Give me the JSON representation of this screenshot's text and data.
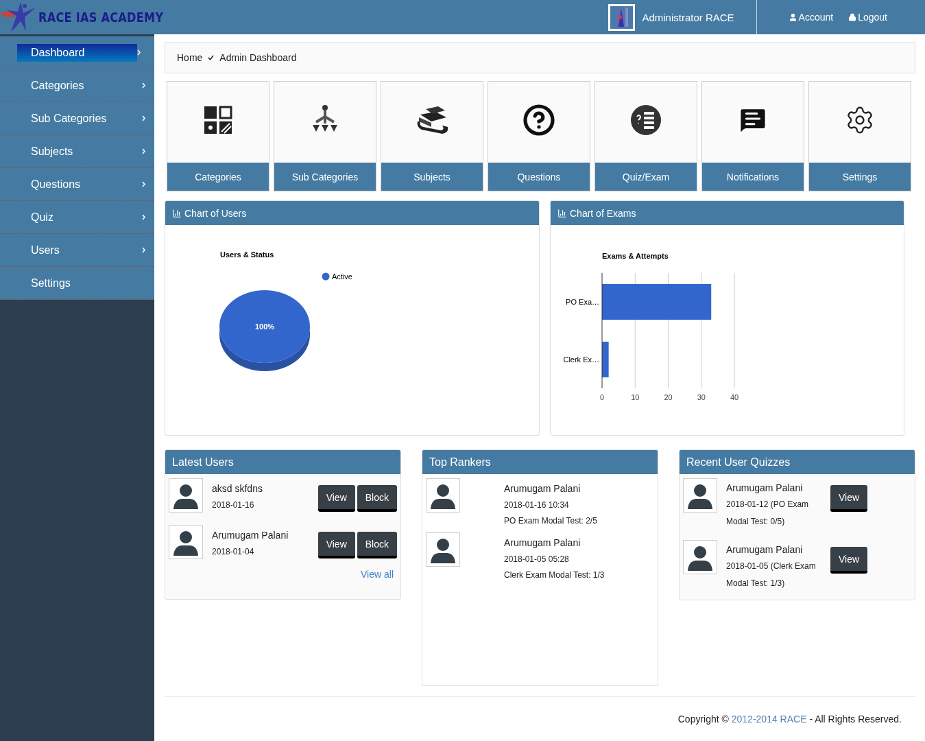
{
  "header": {
    "logo_text": "RACE IAS ACADEMY",
    "user_name": "Administrator RACE",
    "links": [
      {
        "kind": "account",
        "label": "Account"
      },
      {
        "kind": "logout",
        "label": "Logout"
      }
    ]
  },
  "sidebar": {
    "items": [
      {
        "label": "Dashboard",
        "selected": true,
        "has_arrow": true
      },
      {
        "label": "Categories",
        "selected": false,
        "has_arrow": true
      },
      {
        "label": "Sub Categories",
        "selected": false,
        "has_arrow": true
      },
      {
        "label": "Subjects",
        "selected": false,
        "has_arrow": true
      },
      {
        "label": "Questions",
        "selected": false,
        "has_arrow": true
      },
      {
        "label": "Quiz",
        "selected": false,
        "has_arrow": true
      },
      {
        "label": "Users",
        "selected": false,
        "has_arrow": true
      },
      {
        "label": "Settings",
        "selected": false,
        "has_arrow": false
      }
    ]
  },
  "breadcrumb": [
    "Home",
    "Admin Dashboard"
  ],
  "tiles": [
    {
      "kind": "categories",
      "label": "Categories"
    },
    {
      "kind": "subcategories",
      "label": "Sub Categories"
    },
    {
      "kind": "subjects",
      "label": "Subjects"
    },
    {
      "kind": "questions",
      "label": "Questions"
    },
    {
      "kind": "quiz",
      "label": "Quiz/Exam"
    },
    {
      "kind": "notifications",
      "label": "Notifications"
    },
    {
      "kind": "settings",
      "label": "Settings"
    }
  ],
  "charts": [
    {
      "title": "Chart of Users",
      "chart_data": {
        "type": "pie",
        "title": "Users & Status",
        "series": [
          {
            "name": "Active",
            "color": "#3366cc",
            "values": [
              100
            ]
          }
        ],
        "value_labels": [
          "100%"
        ]
      }
    },
    {
      "title": "Chart of Exams",
      "chart_data": {
        "type": "bar",
        "orientation": "horizontal",
        "title": "Exams & Attempts",
        "categories": [
          "PO Exa…",
          "Clerk Ex…"
        ],
        "values": [
          33,
          2
        ],
        "xlim": [
          0,
          40
        ],
        "xticks": [
          0,
          10,
          20,
          30,
          40
        ],
        "grid": true
      }
    }
  ],
  "latest_users": {
    "title": "Latest Users",
    "users": [
      {
        "name": "aksd skfdns",
        "date": "2018-01-16",
        "buttons": [
          "View",
          "Block"
        ]
      },
      {
        "name": "Arumugam Palani",
        "date": "2018-01-04",
        "buttons": [
          "View",
          "Block"
        ]
      }
    ],
    "link": "View all"
  },
  "top_rankers": {
    "title": "Top Rankers",
    "items": [
      {
        "name": "Arumugam Palani",
        "time": "2018-01-16 10:34",
        "result": "PO Exam Modal Test: 2/5"
      },
      {
        "name": "Arumugam Palani",
        "time": "2018-01-05 05:28",
        "result": "Clerk Exam Modal Test: 1/3"
      }
    ]
  },
  "recent_quizzes": {
    "title": "Recent User Quizzes",
    "items": [
      {
        "name": "Arumugam Palani",
        "detail": "2018-01-12 (PO Exam Modal Test: 0/5)",
        "button": "View"
      },
      {
        "name": "Arumugam Palani",
        "detail": "2018-01-05 (Clerk Exam Modal Test: 1/3)",
        "button": "View"
      }
    ]
  },
  "footer": {
    "before": "Copyright © ",
    "link": "2012-2014 RACE",
    "after": " - All Rights Reserved."
  }
}
